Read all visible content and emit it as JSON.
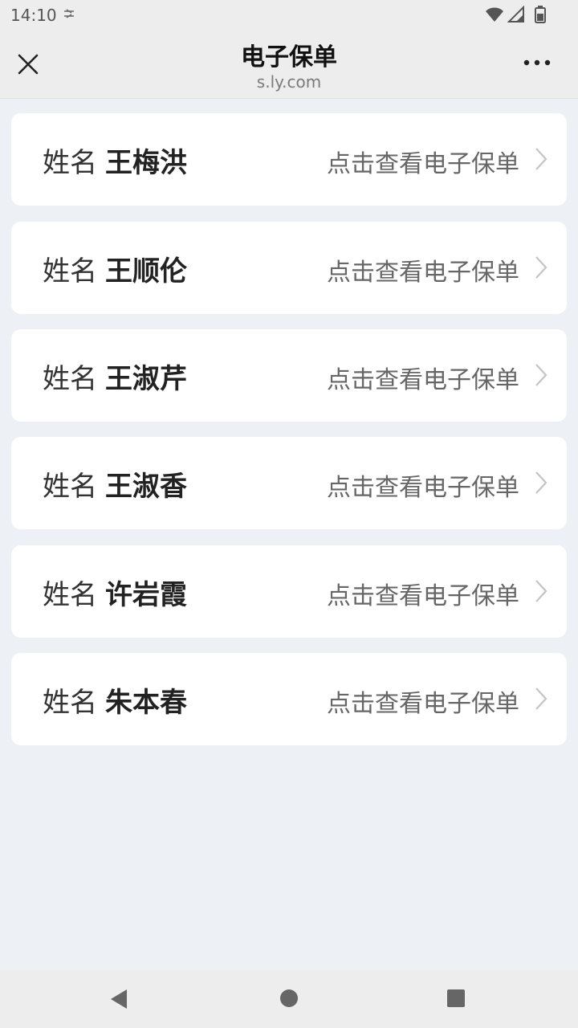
{
  "status_bar": {
    "time": "14:10",
    "icons": [
      "usb-debug-icon",
      "wifi-icon",
      "signal-icon",
      "battery-icon"
    ]
  },
  "nav": {
    "title": "电子保单",
    "subtitle": "s.ly.com",
    "close_icon": "close-icon",
    "more_icon": "more-icon"
  },
  "policies": [
    {
      "label": "姓名",
      "name": "王梅洪",
      "link": "点击查看电子保单"
    },
    {
      "label": "姓名",
      "name": "王顺伦",
      "link": "点击查看电子保单"
    },
    {
      "label": "姓名",
      "name": "王淑芹",
      "link": "点击查看电子保单"
    },
    {
      "label": "姓名",
      "name": "王淑香",
      "link": "点击查看电子保单"
    },
    {
      "label": "姓名",
      "name": "许岩霞",
      "link": "点击查看电子保单"
    },
    {
      "label": "姓名",
      "name": "朱本春",
      "link": "点击查看电子保单"
    }
  ],
  "system_nav": {
    "icons": [
      "back-icon",
      "home-icon",
      "recents-icon"
    ]
  },
  "colors": {
    "page_background": "#edf0f4",
    "bar_background": "#ededed",
    "card_background": "#ffffff",
    "link_text": "#666666"
  }
}
